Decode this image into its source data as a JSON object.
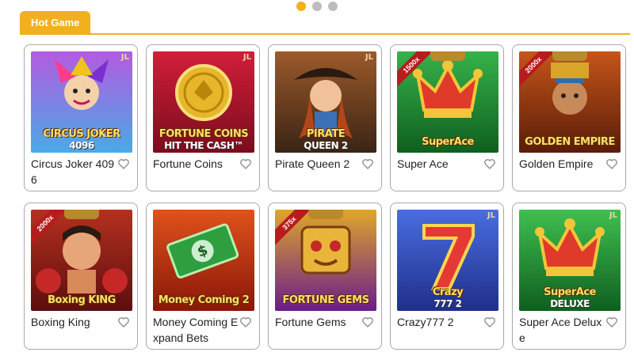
{
  "carousel": {
    "dots": 3,
    "active_index": 0
  },
  "section": {
    "tab_label": "Hot Game"
  },
  "games": [
    {
      "title": "Circus Joker 4096",
      "badge": "JL",
      "ribbon": "",
      "art_line1": "CIRCUS JOKER",
      "art_line2": "4096",
      "colors": [
        "#4aa9e6",
        "#b45be0"
      ],
      "icon": "joker-art"
    },
    {
      "title": "Fortune Coins",
      "badge": "JL",
      "ribbon": "",
      "art_line1": "FORTUNE COINS",
      "art_line2": "HIT THE CASH™",
      "colors": [
        "#7a0c1c",
        "#d21e3a"
      ],
      "icon": "coin-art"
    },
    {
      "title": "Pirate Queen 2",
      "badge": "JL",
      "ribbon": "",
      "art_line1": "PIRATE",
      "art_line2": "QUEEN 2",
      "colors": [
        "#3a2415",
        "#9c5a2a"
      ],
      "icon": "pirate-art"
    },
    {
      "title": "Super Ace",
      "badge": "",
      "ribbon": "1500x",
      "art_line1": "SuperAce",
      "art_line2": "",
      "colors": [
        "#0f5f1f",
        "#36b24a"
      ],
      "icon": "crown-art"
    },
    {
      "title": "Golden Empire",
      "badge": "",
      "ribbon": "2000x",
      "art_line1": "GOLDEN EMPIRE",
      "art_line2": "",
      "colors": [
        "#5a1c08",
        "#c5551a"
      ],
      "icon": "empire-art"
    },
    {
      "title": "Boxing King",
      "badge": "",
      "ribbon": "2000x",
      "art_line1": "Boxing KING",
      "art_line2": "",
      "colors": [
        "#5c0e0e",
        "#b5301f"
      ],
      "icon": "boxer-art"
    },
    {
      "title": "Money Coming Expand Bets",
      "badge": "",
      "ribbon": "",
      "art_line1": "Money Coming 2",
      "art_line2": "",
      "colors": [
        "#8a1608",
        "#e0521c"
      ],
      "icon": "money-art"
    },
    {
      "title": "Fortune Gems",
      "badge": "",
      "ribbon": "375x",
      "art_line1": "FORTUNE GEMS",
      "art_line2": "",
      "colors": [
        "#6a1c8a",
        "#e0a62a"
      ],
      "icon": "gems-art"
    },
    {
      "title": "Crazy777 2",
      "badge": "JL",
      "ribbon": "",
      "art_line1": "Crazy",
      "art_line2": "777 2",
      "colors": [
        "#1f2f8a",
        "#4a6de0"
      ],
      "icon": "seven-art"
    },
    {
      "title": "Super Ace Deluxe",
      "badge": "JL",
      "ribbon": "",
      "art_line1": "SuperAce",
      "art_line2": "DELUXE",
      "colors": [
        "#0f5f1f",
        "#3fbf50"
      ],
      "icon": "crown-art"
    }
  ]
}
